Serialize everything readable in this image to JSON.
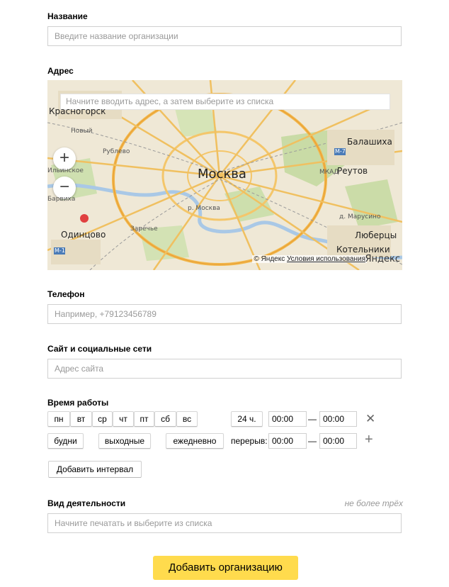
{
  "name": {
    "label": "Название",
    "placeholder": "Введите название организации"
  },
  "address": {
    "label": "Адрес",
    "search_placeholder": "Начните вводить адрес, а затем выберите из списка",
    "zoom_in": "+",
    "zoom_out": "−",
    "map_labels": {
      "moscow": "Москва",
      "krasnogorsk": "Красногорск",
      "balashikha": "Балашиха",
      "reutov": "Реутов",
      "odintsovo": "Одинцово",
      "lyubertsy": "Люберцы",
      "kotelniki": "Котельники",
      "novy": "Новый",
      "rublevo": "Рублево",
      "ilyinskoe": "Ильинское",
      "barvikha": "Барвиха",
      "zarechye": "Заречье",
      "marusino": "д. Марусино",
      "moskva_river": "р. Москва",
      "mkad": "МКАД",
      "m7": "М-7",
      "m1": "М-1"
    },
    "copyright": "© Яндекс",
    "terms": "Условия использования",
    "logo": "Яндекс"
  },
  "phone": {
    "label": "Телефон",
    "placeholder": "Например, +79123456789"
  },
  "website": {
    "label": "Сайт и социальные сети",
    "placeholder": "Адрес сайта"
  },
  "hours": {
    "label": "Время работы",
    "days": [
      "пн",
      "вт",
      "ср",
      "чт",
      "пт",
      "сб",
      "вс"
    ],
    "round_clock": "24 ч.",
    "from": "00:00",
    "dash": "—",
    "to": "00:00",
    "remove": "✕",
    "presets": [
      "будни",
      "выходные",
      "ежедневно"
    ],
    "break_label": "перерыв:",
    "break_from": "00:00",
    "break_to": "00:00",
    "add": "+",
    "add_interval": "Добавить интервал"
  },
  "activity": {
    "label": "Вид деятельности",
    "hint": "не более трёх",
    "placeholder": "Начните печатать и выберите из списка"
  },
  "submit": "Добавить организацию"
}
